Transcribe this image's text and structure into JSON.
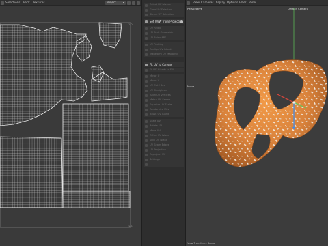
{
  "uv_editor": {
    "menu": [
      "Selections",
      "Pack",
      "Textures"
    ],
    "dropdown_value": "Project",
    "ruler_top_right": "1.0",
    "ruler_bottom_right": "1.0"
  },
  "tools": {
    "items": [
      {
        "label": "Select UV Islands",
        "active": false
      },
      {
        "label": "Grow UV Selection",
        "active": false
      },
      {
        "label": "Shrink UV Selection",
        "active": false
      },
      {
        "label": "Set UVW from Projection",
        "active": true,
        "help": true
      },
      {
        "label": "UV Relax",
        "active": false
      },
      {
        "label": "UV Pack Geometric",
        "active": false
      },
      {
        "label": "UV Relax ABF",
        "active": false
      },
      {
        "label": "UV Packing",
        "active": false
      },
      {
        "label": "Realign UV Islands",
        "active": false
      },
      {
        "label": "Transform UV Mapping",
        "active": false
      },
      {
        "label": "Fit UV to Canvas",
        "active": true
      },
      {
        "label": "Fit UV Islands to Fill",
        "active": false
      },
      {
        "label": "Mirror U",
        "active": false
      },
      {
        "label": "Mirror V",
        "active": false
      },
      {
        "label": "UV Cut / Sew",
        "active": false
      },
      {
        "label": "UV Straighten",
        "active": false
      },
      {
        "label": "Align UV Vertices",
        "active": false
      },
      {
        "label": "Match UV Seams",
        "active": false
      },
      {
        "label": "Equalize UV Scale",
        "active": false
      },
      {
        "label": "Randomize UVs",
        "active": false
      },
      {
        "label": "Brush UV Island",
        "active": false
      },
      {
        "label": "Scale UV",
        "active": false
      },
      {
        "label": "Rotate UV",
        "active": false
      },
      {
        "label": "Move UV",
        "active": false
      },
      {
        "label": "Offset UV Island",
        "active": false
      },
      {
        "label": "Split UV Island",
        "active": false
      },
      {
        "label": "UV Seam Edges",
        "active": false
      },
      {
        "label": "UV Projection",
        "active": false
      },
      {
        "label": "Reproject UV",
        "active": false
      },
      {
        "label": "Settings",
        "active": false
      }
    ]
  },
  "viewport": {
    "menu": [
      "View",
      "Cameras",
      "Display",
      "Options",
      "Filter",
      "Panel"
    ],
    "projection": "Perspective",
    "camera": "Default Camera",
    "mode": "Move",
    "status": "View Transform: Scene",
    "axis_colors": {
      "x": "#e0463c",
      "y": "#5ec85a",
      "z": "#3c8cf0"
    },
    "pretzel_color": "#c97a36"
  }
}
